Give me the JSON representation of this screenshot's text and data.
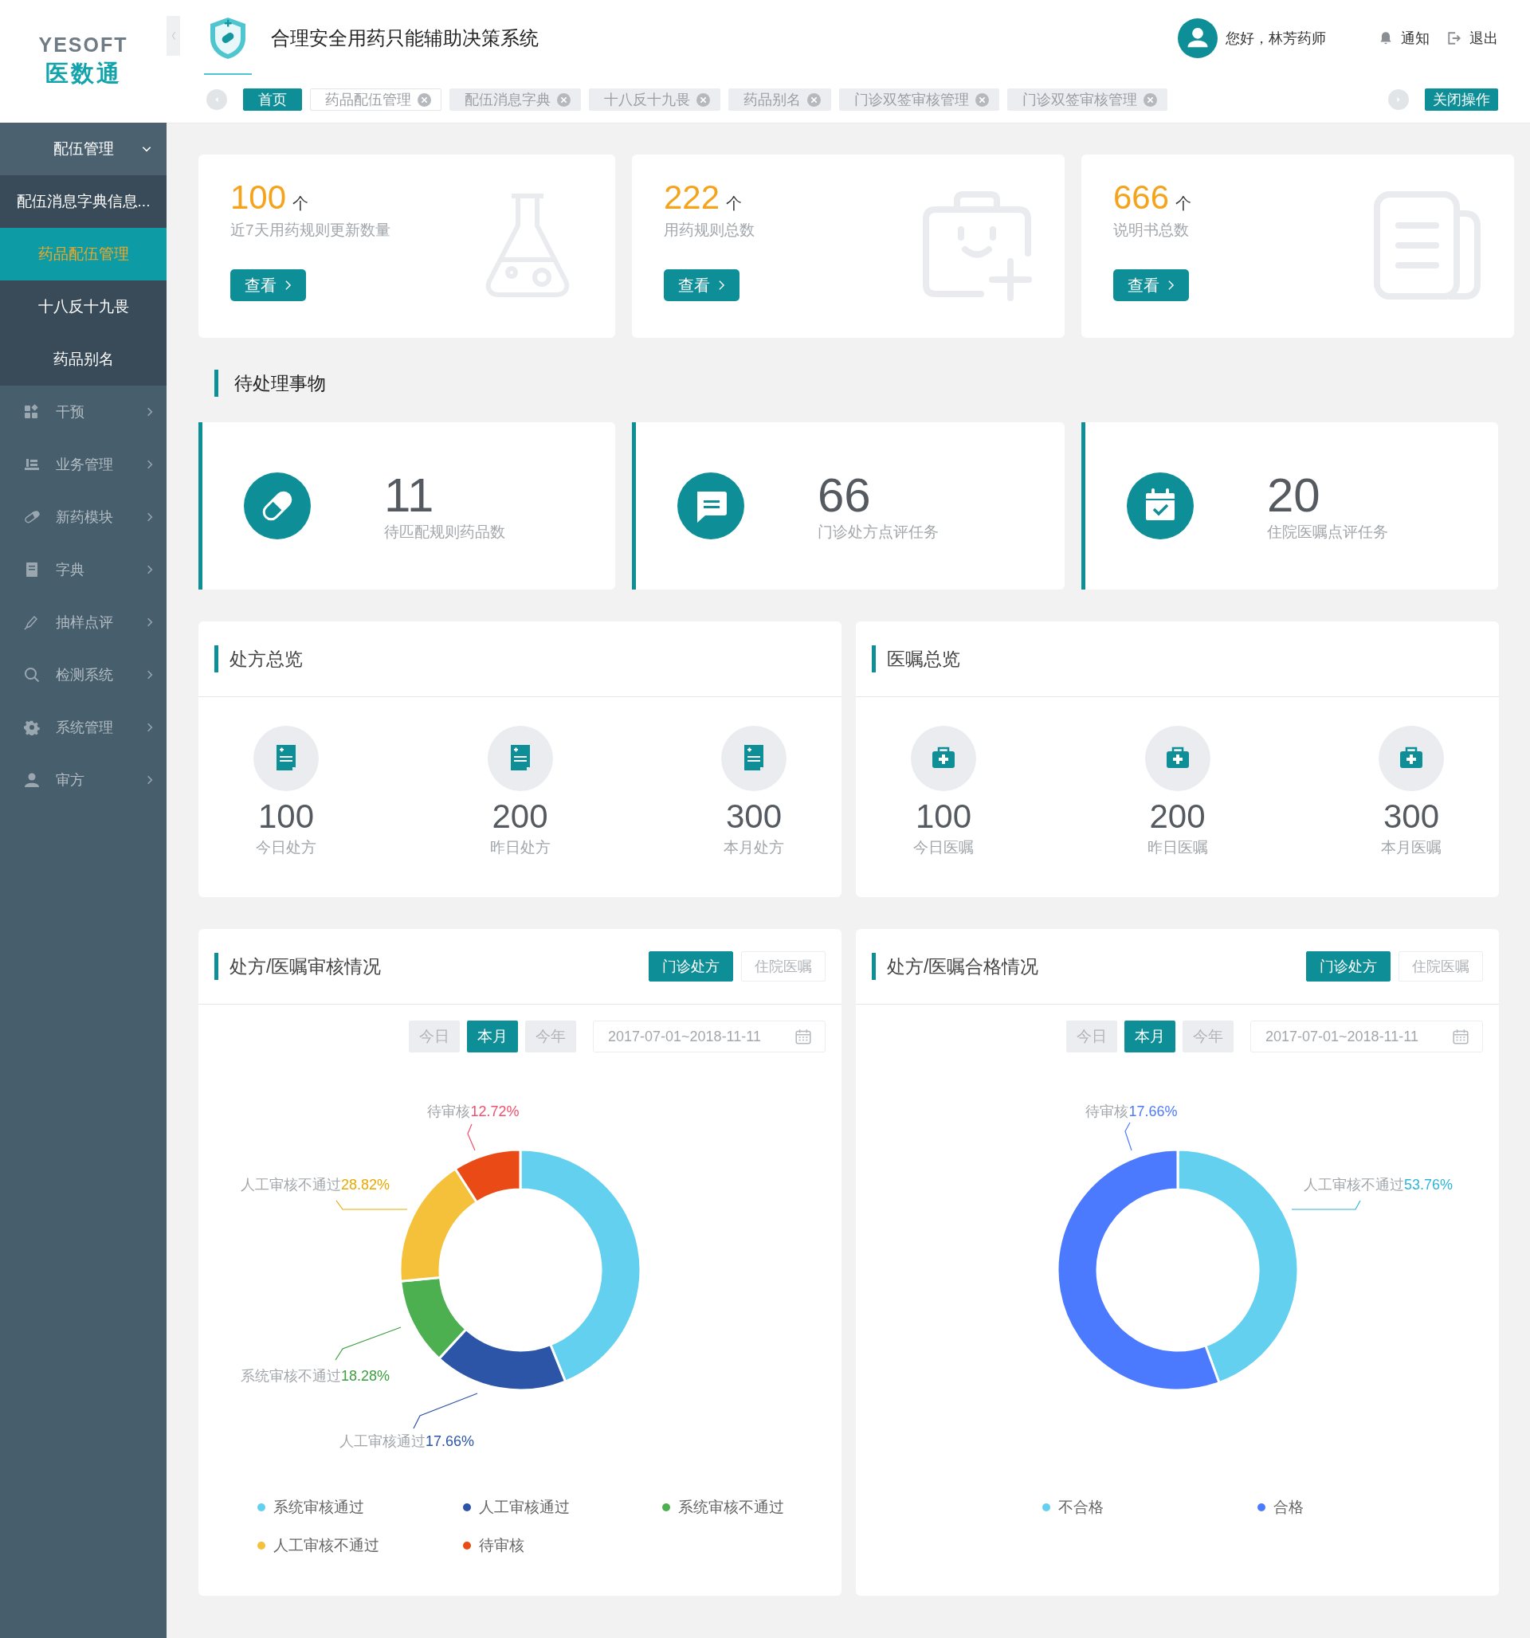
{
  "sidebar": {
    "logo": {
      "brand": "YESOFT",
      "name": "医数通"
    },
    "menu": [
      {
        "label": "配伍管理",
        "expanded": true,
        "children": [
          {
            "label": "配伍消息字典信息...",
            "selected": false
          },
          {
            "label": "药品配伍管理",
            "selected": true
          },
          {
            "label": "十八反十九畏",
            "selected": false
          },
          {
            "label": "药品别名",
            "selected": false
          }
        ]
      },
      {
        "label": "干预",
        "expanded": false
      },
      {
        "label": "业务管理",
        "expanded": false
      },
      {
        "label": "新药模块",
        "expanded": false
      },
      {
        "label": "字典",
        "expanded": false
      },
      {
        "label": "抽样点评",
        "expanded": false
      },
      {
        "label": "检测系统",
        "expanded": false
      },
      {
        "label": "系统管理",
        "expanded": false
      },
      {
        "label": "审方",
        "expanded": false
      }
    ]
  },
  "header": {
    "title": "合理安全用药只能辅助决策系统",
    "user": "您好，林芳药师",
    "notify": "通知",
    "logout": "退出",
    "close_all": "关闭操作",
    "tabs": [
      {
        "label": "首页",
        "selected": true,
        "closable": false,
        "hovered": false
      },
      {
        "label": "药品配伍管理",
        "selected": false,
        "closable": true,
        "hovered": true
      },
      {
        "label": "配伍消息字典",
        "selected": false,
        "closable": true,
        "hovered": false
      },
      {
        "label": "十八反十九畏",
        "selected": false,
        "closable": true,
        "hovered": false
      },
      {
        "label": "药品别名",
        "selected": false,
        "closable": true,
        "hovered": false
      },
      {
        "label": "门诊双签审核管理",
        "selected": false,
        "closable": true,
        "hovered": false
      },
      {
        "label": "门诊双签审核管理",
        "selected": false,
        "closable": true,
        "hovered": false
      }
    ]
  },
  "stats": [
    {
      "value": "100",
      "unit": "个",
      "label": "近7天用药规则更新数量",
      "button": "查看"
    },
    {
      "value": "222",
      "unit": "个",
      "label": "用药规则总数",
      "button": "查看"
    },
    {
      "value": "666",
      "unit": "个",
      "label": "说明书总数",
      "button": "查看"
    }
  ],
  "pending": {
    "title": "待处理事物",
    "items": [
      {
        "value": "11",
        "label": "待匹配规则药品数"
      },
      {
        "value": "66",
        "label": "门诊处方点评任务"
      },
      {
        "value": "20",
        "label": "住院医嘱点评任务"
      }
    ]
  },
  "overviews": [
    {
      "title": "处方总览",
      "items": [
        {
          "value": "100",
          "label": "今日处方"
        },
        {
          "value": "200",
          "label": "昨日处方"
        },
        {
          "value": "300",
          "label": "本月处方"
        }
      ]
    },
    {
      "title": "医嘱总览",
      "items": [
        {
          "value": "100",
          "label": "今日医嘱"
        },
        {
          "value": "200",
          "label": "昨日医嘱"
        },
        {
          "value": "300",
          "label": "本月医嘱"
        }
      ]
    }
  ],
  "charts": [
    {
      "title": "处方/医嘱审核情况",
      "toggles": [
        {
          "label": "门诊处方",
          "selected": true
        },
        {
          "label": "住院医嘱",
          "selected": false
        }
      ],
      "periods": [
        {
          "label": "今日",
          "selected": false
        },
        {
          "label": "本月",
          "selected": true
        },
        {
          "label": "今年",
          "selected": false
        }
      ],
      "date_range": "2017-07-01~2018-11-11",
      "chart_data": {
        "type": "donut",
        "categories": [
          "系统审核通过",
          "人工审核通过",
          "系统审核不通过",
          "人工审核不通过",
          "待审核"
        ],
        "values": [
          43.9,
          17.9,
          11.7,
          17.4,
          9.1
        ],
        "colors": [
          "#63d0ef",
          "#2c55a8",
          "#4caf50",
          "#f6c13a",
          "#ea4a16"
        ]
      },
      "slice_labels": [
        {
          "name": "待审核",
          "value": "12.72%",
          "color": "#f0506e"
        },
        {
          "name": "人工审核不通过",
          "value": "28.82%",
          "color": "#e8a900"
        },
        {
          "name": "系统审核不通过",
          "value": "18.28%",
          "color": "#3d9f41"
        },
        {
          "name": "人工审核通过",
          "value": "17.66%",
          "color": "#2c55a8"
        }
      ]
    },
    {
      "title": "处方/医嘱合格情况",
      "toggles": [
        {
          "label": "门诊处方",
          "selected": true
        },
        {
          "label": "住院医嘱",
          "selected": false
        }
      ],
      "periods": [
        {
          "label": "今日",
          "selected": false
        },
        {
          "label": "本月",
          "selected": true
        },
        {
          "label": "今年",
          "selected": false
        }
      ],
      "date_range": "2017-07-01~2018-11-11",
      "chart_data": {
        "type": "donut",
        "categories": [
          "不合格",
          "合格"
        ],
        "values": [
          44.4,
          55.6
        ],
        "colors": [
          "#63d0ef",
          "#4c7aff"
        ]
      },
      "slice_labels": [
        {
          "name": "待审核",
          "value": "17.66%",
          "color": "#4c7aff"
        },
        {
          "name": "人工审核不通过",
          "value": "53.76%",
          "color": "#2fb4dc"
        }
      ]
    }
  ]
}
